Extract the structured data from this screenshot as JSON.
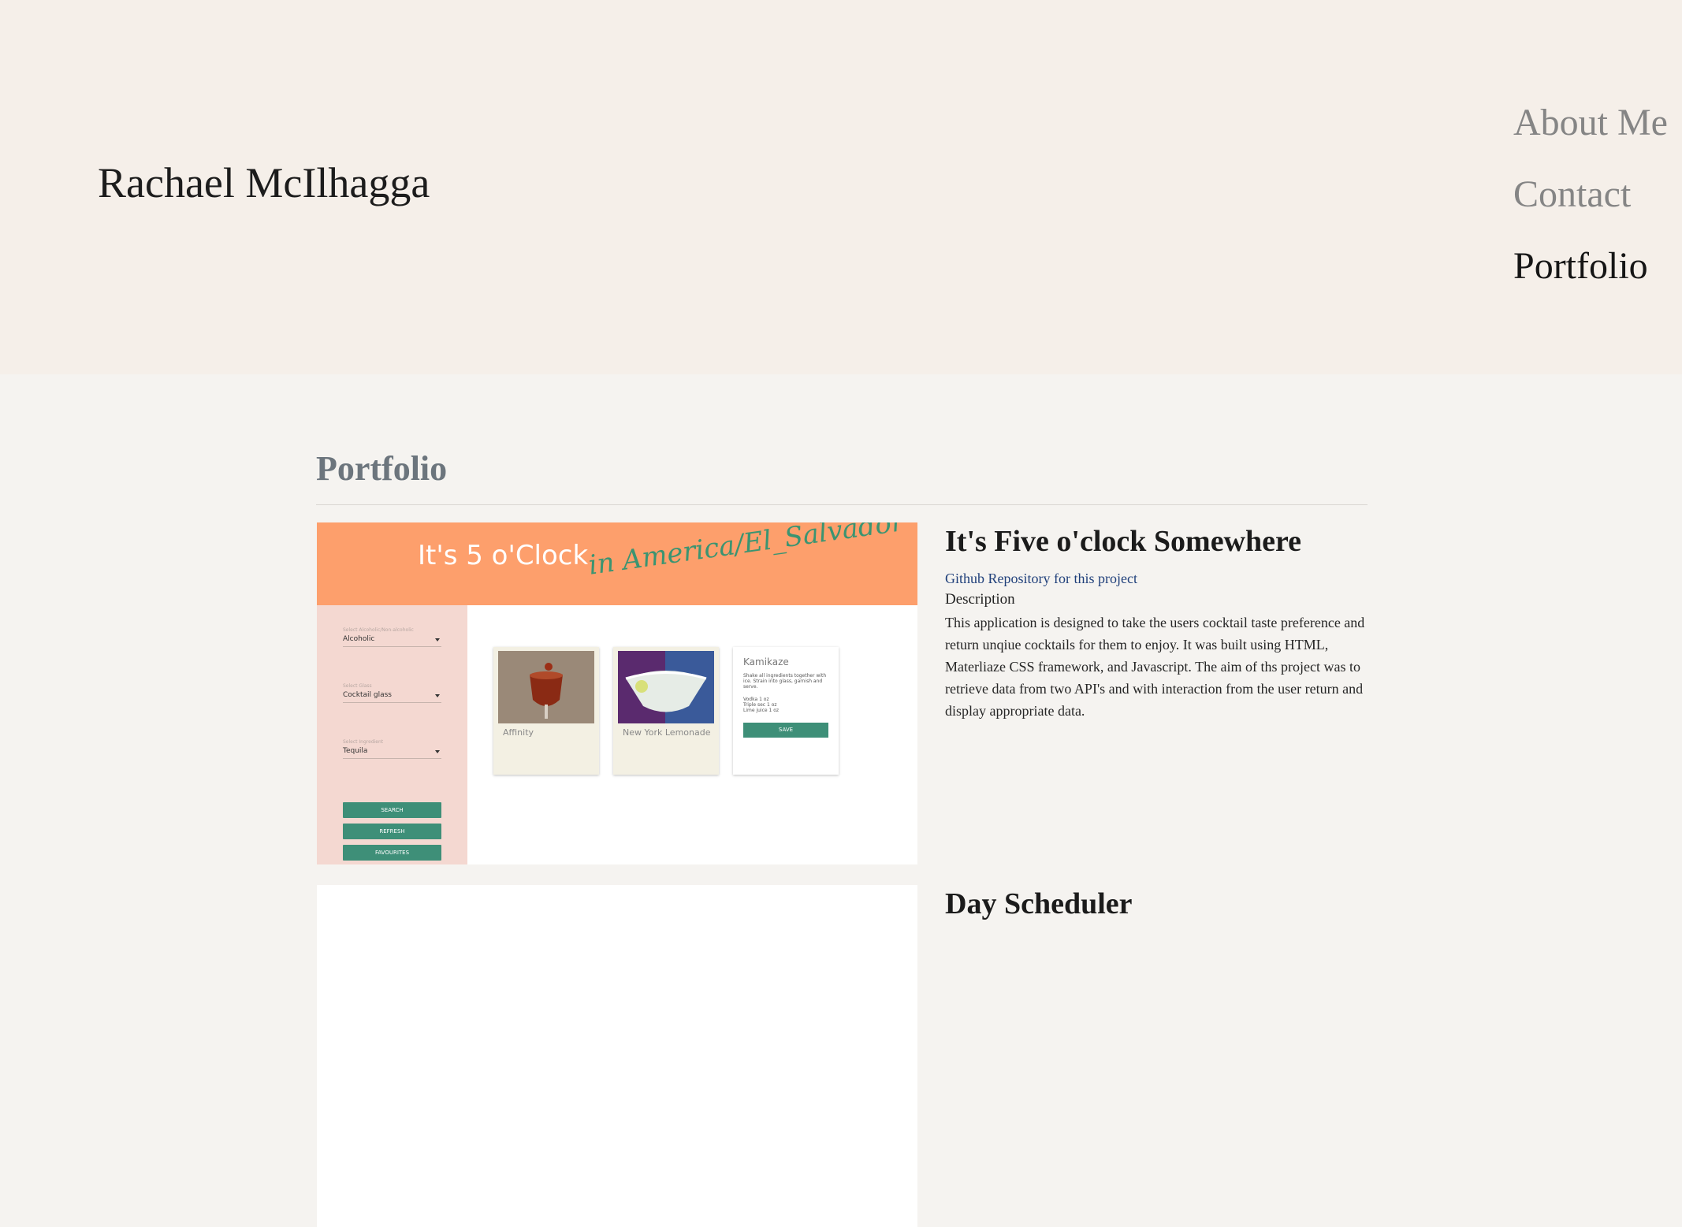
{
  "header": {
    "site_name": "Rachael McIlhagga",
    "nav": [
      {
        "label": "About Me",
        "active": false
      },
      {
        "label": "Contact",
        "active": false
      },
      {
        "label": "Portfolio",
        "active": true
      }
    ]
  },
  "main": {
    "section_title": "Portfolio",
    "projects": [
      {
        "title": "It's Five o'clock Somewhere",
        "repo_link": "Github Repository for this project",
        "description_label": "Description",
        "description": "This application is designed to take the users cocktail taste preference and return unqiue cocktails for them to enjoy. It was built using HTML, Materliaze CSS framework, and Javascript. The aim of ths project was to retrieve data from two API's and with interaction from the user return and display appropriate data.",
        "screenshot": {
          "banner_text": "It's 5 o'Clock",
          "banner_script": "in America/El_Salvador",
          "fields": [
            {
              "label": "Select Alcoholic/Non-alcoholic",
              "value": "Alcoholic"
            },
            {
              "label": "Select Glass",
              "value": "Cocktail glass"
            },
            {
              "label": "Select Ingredient",
              "value": "Tequila"
            }
          ],
          "buttons": [
            "SEARCH",
            "REFRESH",
            "FAVOURITES"
          ],
          "cards": [
            "Affinity",
            "New York Lemonade"
          ],
          "recipe": {
            "title": "Kamikaze",
            "instructions": "Shake all ingredients together with ice. Strain into glass, garnish and serve.",
            "ingredients": [
              "Vodka 1 oz",
              "Triple sec 1 oz",
              "Lime juice 1 oz"
            ],
            "save_label": "SAVE"
          }
        }
      },
      {
        "title": "Day Scheduler"
      }
    ]
  },
  "colors": {
    "header_bg": "#f5efe9",
    "page_bg": "#f5f3f0",
    "banner_orange": "#fd9f6c",
    "sidebar_pink": "#f4d8d1",
    "button_green": "#3e8f78",
    "link_blue": "#1f3f7a"
  }
}
